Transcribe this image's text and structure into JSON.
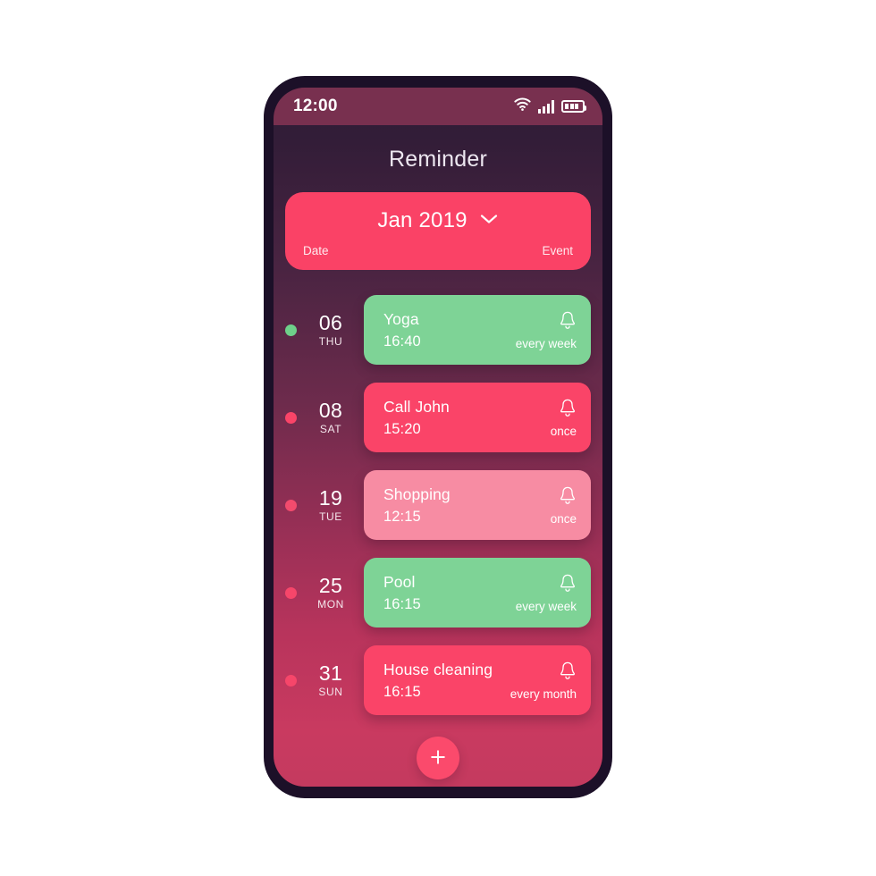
{
  "phone": {
    "status_bar": {
      "time": "12:00",
      "wifi_icon": "wifi-icon",
      "signal_icon": "cellular-signal-icon",
      "battery_icon": "battery-icon"
    },
    "app_title": "Reminder"
  },
  "header": {
    "month_label": "Jan 2019",
    "chevron_icon": "chevron-down-icon",
    "col_date": "Date",
    "col_event": "Event",
    "bg_color": "#fa4266"
  },
  "reminders": [
    {
      "day": "06",
      "dow": "THU",
      "title": "Yoga",
      "time": "16:40",
      "repeat": "every week",
      "card_color": "#7ed396",
      "dot_color": "#6ed08a",
      "bell_icon": "bell-icon"
    },
    {
      "day": "08",
      "dow": "SAT",
      "title": "Call John",
      "time": "15:20",
      "repeat": "once",
      "card_color": "#fa4468",
      "dot_color": "#fa4468",
      "bell_icon": "bell-icon"
    },
    {
      "day": "19",
      "dow": "TUE",
      "title": "Shopping",
      "time": "12:15",
      "repeat": "once",
      "card_color": "#f78ca3",
      "dot_color": "#f24b6d",
      "bell_icon": "bell-icon"
    },
    {
      "day": "25",
      "dow": "MON",
      "title": "Pool",
      "time": "16:15",
      "repeat": "every week",
      "card_color": "#7ed396",
      "dot_color": "#f6466a",
      "bell_icon": "bell-icon"
    },
    {
      "day": "31",
      "dow": "SUN",
      "title": "House cleaning",
      "time": "16:15",
      "repeat": "every month",
      "card_color": "#fa4468",
      "dot_color": "#f6466a",
      "bell_icon": "bell-icon"
    }
  ],
  "fab": {
    "icon": "plus-icon",
    "color": "#fb4a6c"
  }
}
